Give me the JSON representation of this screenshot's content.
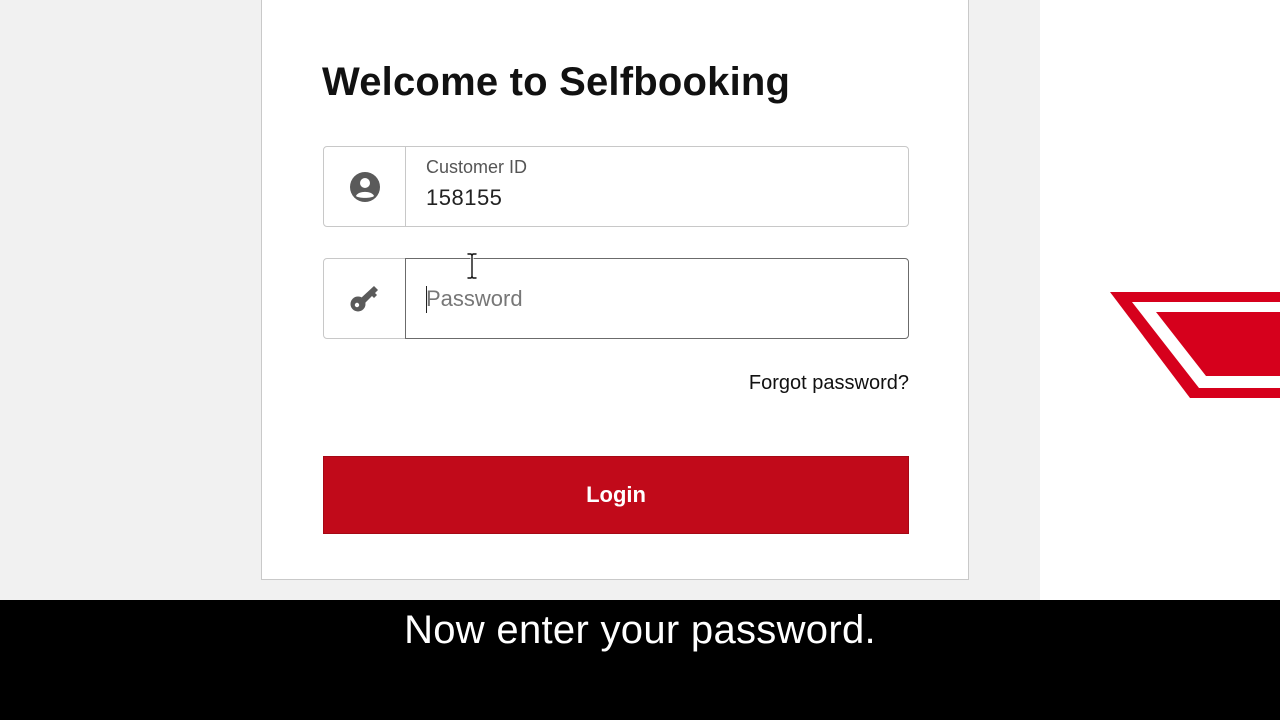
{
  "page": {
    "title": "Welcome to Selfbooking"
  },
  "customer_field": {
    "label": "Customer ID",
    "value": "158155",
    "icon": "user-circle-icon"
  },
  "password_field": {
    "placeholder": "Password",
    "value": "",
    "icon": "key-icon"
  },
  "links": {
    "forgot_password": "Forgot password?"
  },
  "login_button": {
    "label": "Login"
  },
  "subtitle": {
    "text": "Now enter your password."
  },
  "colors": {
    "brand_red": "#c10a1a",
    "logo_red": "#d6001c",
    "background": "#f1f1f1",
    "card": "#ffffff",
    "subtitle_bar": "#000000"
  }
}
